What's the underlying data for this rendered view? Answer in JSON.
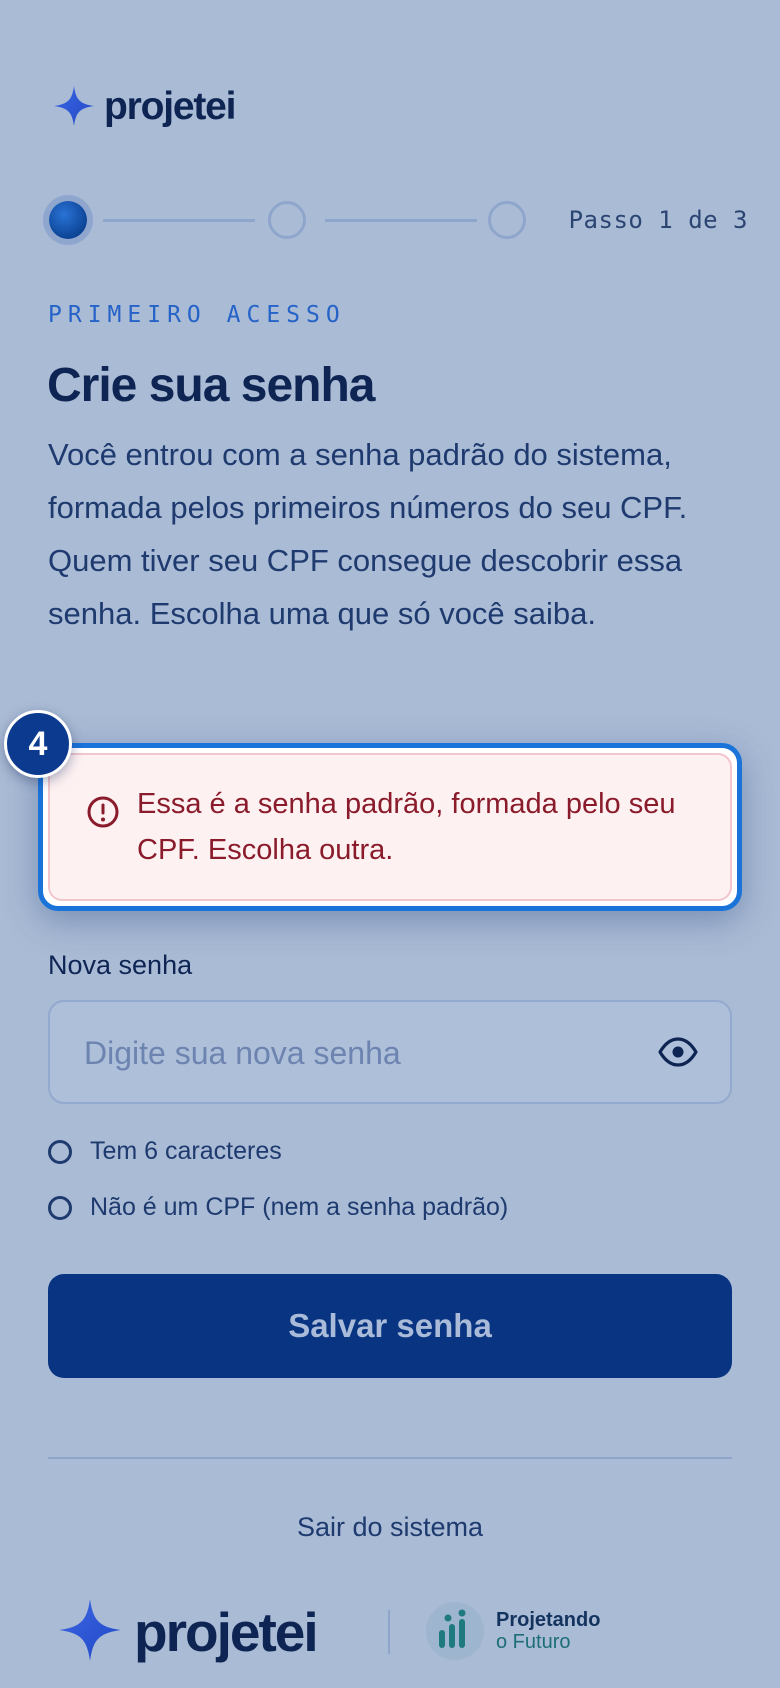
{
  "header": {
    "brand_name": "projetei"
  },
  "stepper": {
    "current": 1,
    "total": 3,
    "label": "Passo 1 de 3"
  },
  "page": {
    "eyebrow": "PRIMEIRO ACESSO",
    "title": "Crie sua senha",
    "description": "Você entrou com a senha padrão do sistema, formada pelos primeiros números do seu CPF. Quem tiver seu CPF consegue descobrir essa senha. Escolha uma que só você saiba."
  },
  "highlight": {
    "badge": "4"
  },
  "error": {
    "message": "Essa é a senha padrão, formada pelo seu CPF. Escolha outra."
  },
  "form": {
    "password_label": "Nova senha",
    "password_placeholder": "Digite sua nova senha",
    "password_value": "",
    "rules": [
      {
        "label": "Tem 6 caracteres"
      },
      {
        "label": "Não é um CPF (nem a senha padrão)"
      }
    ],
    "submit_label": "Salvar senha"
  },
  "footer": {
    "logout_label": "Sair do sistema",
    "brand_name": "projetei",
    "partner_name": "Projetando",
    "partner_sub": "o Futuro"
  },
  "colors": {
    "background": "#aabbd5",
    "primary": "#083481",
    "accent": "#1a73d9",
    "error_text": "#8a1b2b",
    "error_bg": "#fdf1f2"
  },
  "icons": {
    "brand": "four-point-star-icon",
    "error": "alert-circle-icon",
    "password_toggle": "eye-icon",
    "partner": "bar-chart-icon"
  }
}
